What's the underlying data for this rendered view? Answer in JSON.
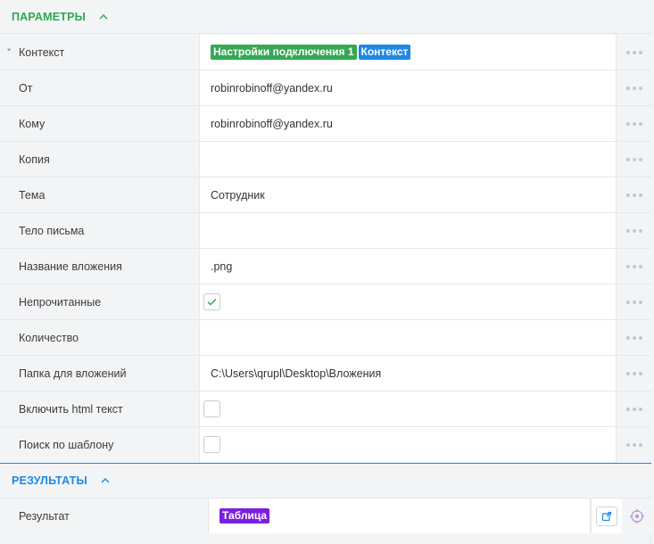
{
  "params_section": {
    "title": "ПАРАМЕТРЫ"
  },
  "results_section": {
    "title": "РЕЗУЛЬТАТЫ"
  },
  "rows": [
    {
      "label": "Контекст",
      "required_mark": "*",
      "tag1": "Настройки подключения 1",
      "tag2": "Контекст"
    },
    {
      "label": "От",
      "value": "robinrobinoff@yandex.ru"
    },
    {
      "label": "Кому",
      "value": "robinrobinoff@yandex.ru"
    },
    {
      "label": "Копия",
      "value": ""
    },
    {
      "label": "Тема",
      "value": "Сотрудник"
    },
    {
      "label": "Тело письма",
      "value": ""
    },
    {
      "label": "Название вложения",
      "value": ".png"
    },
    {
      "label": "Непрочитанные",
      "checked": true
    },
    {
      "label": "Количество",
      "value": ""
    },
    {
      "label": "Папка для вложений",
      "value": "C:\\Users\\qrupl\\Desktop\\Вложения"
    },
    {
      "label": "Включить html текст",
      "checked": false
    },
    {
      "label": "Поиск по шаблону",
      "checked": false
    }
  ],
  "result_row": {
    "label": "Результат",
    "tag": "Таблица"
  },
  "colors": {
    "params_accent": "#2fa84f",
    "results_accent": "#1e88e5",
    "tag_green": "#34a853",
    "tag_blue": "#1e88e5",
    "tag_purple": "#7b1fe0"
  }
}
